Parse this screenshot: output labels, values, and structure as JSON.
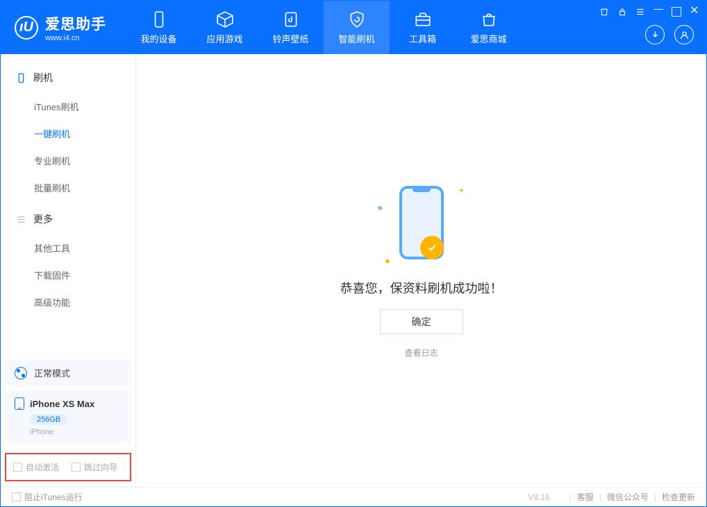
{
  "app": {
    "title": "爱思助手",
    "site": "www.i4.cn"
  },
  "tabs": {
    "device": "我的设备",
    "apps": "应用游戏",
    "ringtone": "铃声壁纸",
    "flash": "智能刷机",
    "toolbox": "工具箱",
    "store": "爱思商城"
  },
  "sidebar": {
    "group_flash": "刷机",
    "items_flash": {
      "itunes": "iTunes刷机",
      "onekey": "一键刷机",
      "pro": "专业刷机",
      "batch": "批量刷机"
    },
    "group_more": "更多",
    "items_more": {
      "other": "其他工具",
      "firmware": "下载固件",
      "advanced": "高级功能"
    }
  },
  "device": {
    "mode": "正常模式",
    "name": "iPhone XS Max",
    "storage": "256GB",
    "type": "iPhone"
  },
  "options": {
    "auto_activate": "自动激活",
    "skip_guide": "跳过向导"
  },
  "main": {
    "message": "恭喜您，保资料刷机成功啦！",
    "ok": "确定",
    "view_log": "查看日志"
  },
  "footer": {
    "block_itunes": "阻止iTunes运行",
    "version": "V8.16",
    "support": "客服",
    "wechat": "微信公众号",
    "update": "检查更新"
  }
}
